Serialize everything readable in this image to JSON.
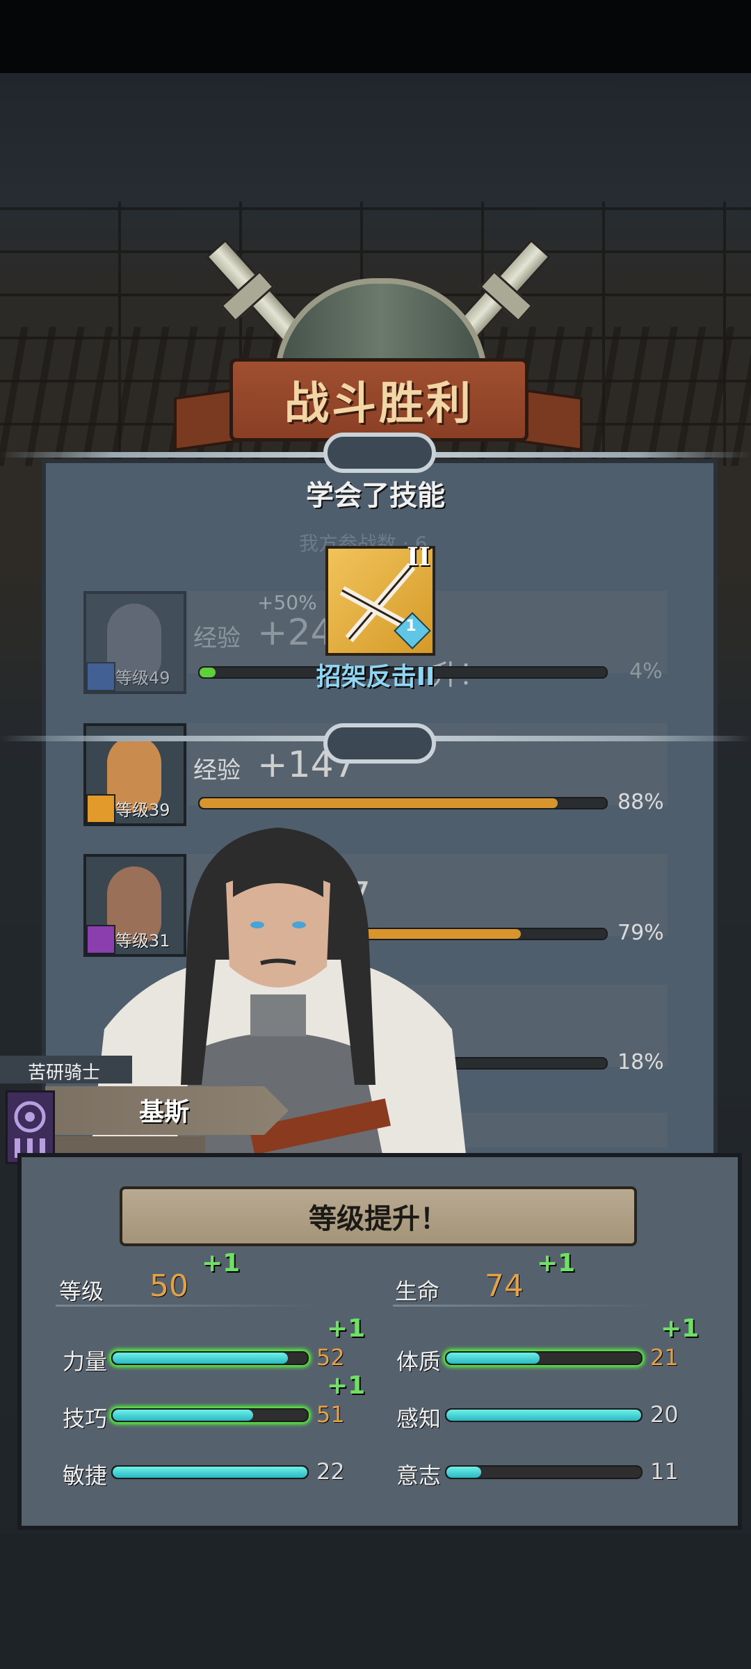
{
  "banner": {
    "title": "战斗胜利"
  },
  "skill_learned": {
    "heading": "学会了技能",
    "faded_text": "我方参战数 · 6",
    "skill_name": "招架反击II",
    "skill_tier": "II",
    "skill_rank": "1"
  },
  "party": [
    {
      "level": "等级49",
      "exp_label": "经验",
      "exp_gain": "+24",
      "bonus": "+50%",
      "overlay": "升！",
      "percent": "4%",
      "fill": 0.04,
      "bar_color": "#5fcf3a"
    },
    {
      "level": "等级39",
      "exp_label": "经验",
      "exp_gain": "+147",
      "percent": "88%",
      "fill": 0.88,
      "bar_color": "#d8952e"
    },
    {
      "level": "等级31",
      "exp_label": "经",
      "exp_gain": "7",
      "percent": "79%",
      "fill": 0.79,
      "bar_color": "#d8952e"
    },
    {
      "percent": "18%",
      "fill": 0.18,
      "bar_color": "#d8952e"
    }
  ],
  "character": {
    "class": "苦研骑士",
    "name": "基斯"
  },
  "level_up": {
    "title": "等级提升！",
    "level": {
      "label": "等级",
      "value": "50",
      "plus": "+1"
    },
    "hp": {
      "label": "生命",
      "value": "74",
      "plus": "+1"
    },
    "stats_left": [
      {
        "label": "力量",
        "value": "52",
        "plus": "+1",
        "fill": 0.9
      },
      {
        "label": "技巧",
        "value": "51",
        "plus": "+1",
        "fill": 0.72
      },
      {
        "label": "敏捷",
        "value": "22",
        "plus": "",
        "fill": 1.0
      }
    ],
    "stats_right": [
      {
        "label": "体质",
        "value": "21",
        "plus": "+1",
        "fill": 0.48
      },
      {
        "label": "感知",
        "value": "20",
        "plus": "",
        "fill": 1.0
      },
      {
        "label": "意志",
        "value": "11",
        "plus": "",
        "fill": 0.18
      }
    ]
  },
  "icons": [
    "crossed-swords-icon",
    "shield-icon",
    "staff-icon",
    "eye-sigil-icon",
    "diamond-gem-icon"
  ]
}
